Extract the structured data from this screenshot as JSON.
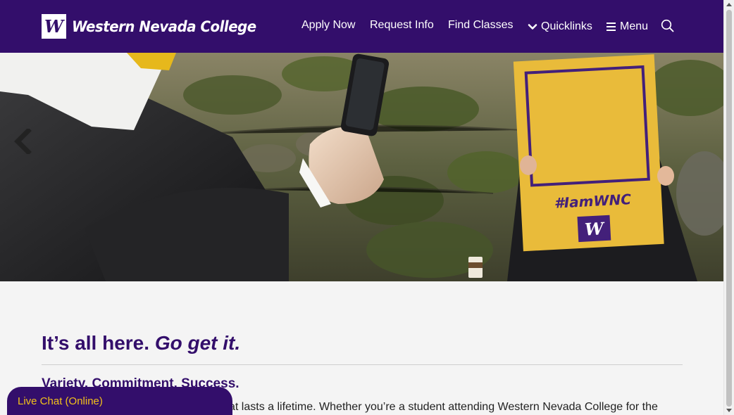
{
  "header": {
    "logo_mark": "W",
    "logo_text": "Western Nevada College",
    "nav": {
      "apply": "Apply Now",
      "request": "Request Info",
      "find": "Find Classes",
      "quicklinks": "Quicklinks",
      "menu": "Menu"
    },
    "icons": [
      "chevron-down-icon",
      "hamburger-icon",
      "search-icon"
    ]
  },
  "hero": {
    "frame_hashtag": "#IamWNC",
    "frame_logo": "W",
    "prev_icon": "chevron-left-icon"
  },
  "main": {
    "headline_plain": "It’s all here. ",
    "headline_emph": "Go get it.",
    "subhead": "Variety. Commitment. Success.",
    "body": "at lasts a lifetime.  Whether you’re a student attending Western Nevada College for the"
  },
  "chat": {
    "label": "Live Chat (Online)"
  },
  "colors": {
    "brand_purple": "#330e6b",
    "gold": "#f3c21a",
    "background": "#f4f4f4"
  }
}
